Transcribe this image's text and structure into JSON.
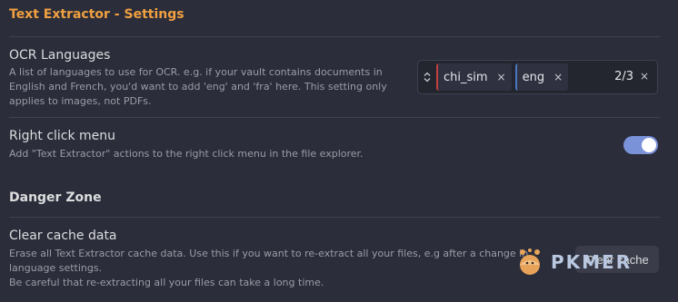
{
  "header": {
    "title": "Text Extractor - Settings"
  },
  "ocr": {
    "name": "OCR Languages",
    "desc_line1": "A list of languages to use for OCR. e.g. if your vault contains documents in",
    "desc_line2": "English and French, you'd want to add 'eng' and 'fra' here. This setting only",
    "desc_line3": "applies to images, not PDFs.",
    "selected": [
      {
        "label": "chi_sim",
        "remove": "×",
        "accent": "#c04040"
      },
      {
        "label": "eng",
        "remove": "×",
        "accent": "#4a78c0"
      }
    ],
    "count": "2/3",
    "clear": "×",
    "sort_icon": "sort-up-down-icon"
  },
  "right_click": {
    "name": "Right click menu",
    "desc": "Add \"Text Extractor\" actions to the right click menu in the file explorer.",
    "enabled": true
  },
  "danger": {
    "heading": "Danger Zone"
  },
  "cache": {
    "name": "Clear cache data",
    "desc_line1": "Erase all Text Extractor cache data. Use this if you want to re-extract all your files, e.g after a change in",
    "desc_line2": "language settings.",
    "desc_line3": "Be careful that re-extracting all your files can take a long time.",
    "button_label": "Clear cache"
  },
  "watermark": {
    "text": "PKMER"
  },
  "colors": {
    "accent": "#f0a040",
    "toggle_on": "#7a92d8"
  }
}
